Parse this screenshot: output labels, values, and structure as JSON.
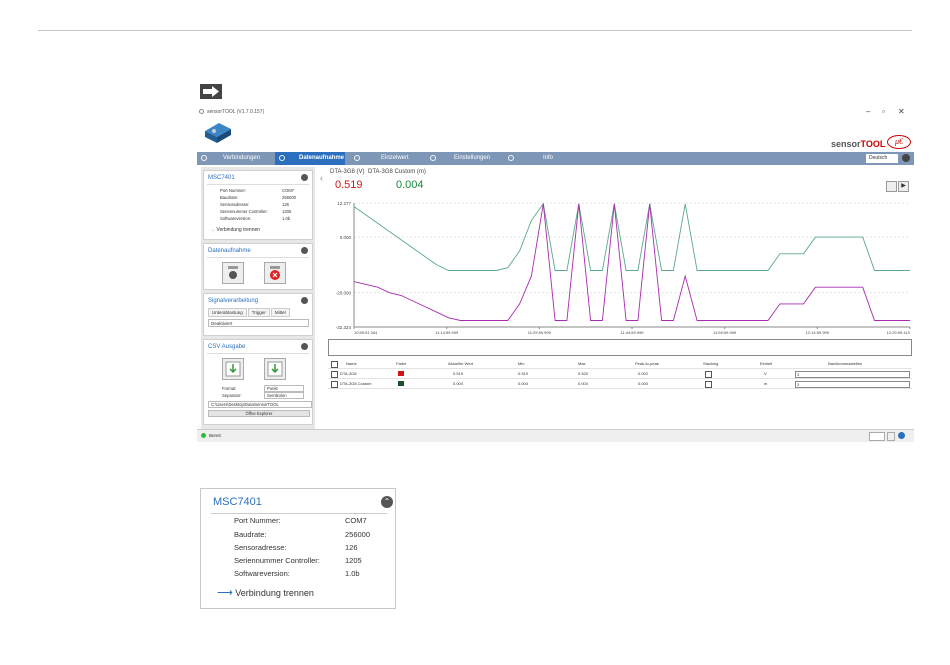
{
  "titlebar": {
    "title": "sensorTOOL (V1.7.0.157)",
    "minimize": "–",
    "maximize": "▫",
    "close": "✕"
  },
  "brand": {
    "sensor": "sensor",
    "tool": "TOOL",
    "logo": "μ€"
  },
  "nav": {
    "items": [
      {
        "label": "Verbindungen",
        "active": false
      },
      {
        "label": "Datenaufnahme",
        "active": true
      },
      {
        "label": "Einzelwert",
        "active": false
      },
      {
        "label": "Einstellungen",
        "active": false
      },
      {
        "label": "Info",
        "active": false
      }
    ],
    "language": "Deutsch"
  },
  "left": {
    "device": {
      "title": "MSC7401",
      "rows": [
        {
          "key": "Port Nummer:",
          "value": "COM7"
        },
        {
          "key": "Baudrate:",
          "value": "256000"
        },
        {
          "key": "Sensoradresse:",
          "value": "126"
        },
        {
          "key": "Seriennummer Controller:",
          "value": "1205"
        },
        {
          "key": "Softwareversion:",
          "value": "1.0b"
        }
      ],
      "disconnect": "Verbindung trennen"
    },
    "datenaufnahme": {
      "title": "Datenaufnahme"
    },
    "signal": {
      "title": "Signalverarbeitung",
      "tabs": [
        "Unterabtastung",
        "Trigger",
        "Mittel"
      ],
      "select": "Deaktiviert"
    },
    "csv": {
      "title": "CSV Ausgabe",
      "format_label": "Format:",
      "format_value": "Punkt",
      "separator_label": "Separator:",
      "separator_value": "Semikolon",
      "path": "C:\\Users\\Desktop\\Data\\sensorTOOL",
      "explorer": "Öffne Explorer"
    }
  },
  "readings": [
    {
      "label": "DTA-3G8 (V)",
      "value": "0.519",
      "color": "#d01616"
    },
    {
      "label": "DTA-3G8 Custom (m)",
      "value": "0.004",
      "color": "#1a8a3a"
    }
  ],
  "chart_data": {
    "type": "line",
    "yticks": [
      "12.277",
      "0.000",
      "-20.000",
      "-32.324"
    ],
    "xticks": [
      "10:59:51.344",
      "11:14:59.999",
      "11:29:59.999",
      "11:44:59.999",
      "11:59:59.999",
      "12:14:59.999",
      "12:29:59.410"
    ],
    "series": [
      {
        "name": "DTA-3G8",
        "color": "#5aa98a",
        "values": [
          11,
          8,
          5,
          2,
          -1,
          -4,
          -7,
          -10,
          -12,
          -12,
          -12,
          -12,
          -12,
          -11,
          -5,
          6,
          12,
          -12,
          -12,
          12,
          -12,
          -12,
          12,
          -12,
          -12,
          12,
          -12,
          -12,
          12,
          -12,
          -12,
          -12,
          -12,
          -12,
          -12,
          -12,
          -6,
          -6,
          -6,
          0,
          0,
          0,
          0,
          0,
          -12,
          -12,
          -12,
          -12
        ]
      },
      {
        "name": "DTA-3G8 Custom",
        "color": "#a82bb0",
        "values": [
          -16,
          -17,
          -18,
          -20,
          -21,
          -23,
          -25,
          -27,
          -29,
          -30,
          -30,
          -30,
          -30,
          -30,
          -24,
          -14,
          12,
          -30,
          -30,
          12,
          -30,
          -30,
          12,
          -30,
          -30,
          12,
          -30,
          -30,
          -14,
          -30,
          -30,
          -30,
          -30,
          -30,
          -30,
          -30,
          -24,
          -24,
          -24,
          -18,
          -18,
          -18,
          -18,
          -18,
          -30,
          -30,
          -30,
          -30
        ]
      }
    ],
    "ylim": [
      -32.324,
      12.277
    ],
    "grid": true
  },
  "table": {
    "headers": [
      "Name",
      "Farbe",
      "Aktueller Wert",
      "Min",
      "Max",
      "Peak-to-peak",
      "Stacking",
      "Einheit",
      "Nachkommastellen"
    ],
    "rows": [
      {
        "name": "DTA-3G8",
        "color": "#d01616",
        "current": "0.519",
        "min": "0.519",
        "max": "0.520",
        "p2p": "0.002",
        "unit": "V",
        "digits": "3"
      },
      {
        "name": "DTA-3G8 Custom",
        "color": "#1f4e2c",
        "current": "0.004",
        "min": "0.004",
        "max": "0.004",
        "p2p": "0.000",
        "unit": "m",
        "digits": "3"
      }
    ]
  },
  "status": {
    "text": "Bereit",
    "color": "#2cba3c"
  },
  "zoom": {
    "title": "MSC7401",
    "rows": [
      {
        "key": "Port Nummer:",
        "value": "COM7"
      },
      {
        "key": "Baudrate:",
        "value": "256000"
      },
      {
        "key": "Sensoradresse:",
        "value": "126"
      },
      {
        "key": "Seriennummer Controller:",
        "value": "1205"
      },
      {
        "key": "Softwareversion:",
        "value": "1.0b"
      }
    ],
    "disconnect": "Verbindung trennen"
  }
}
